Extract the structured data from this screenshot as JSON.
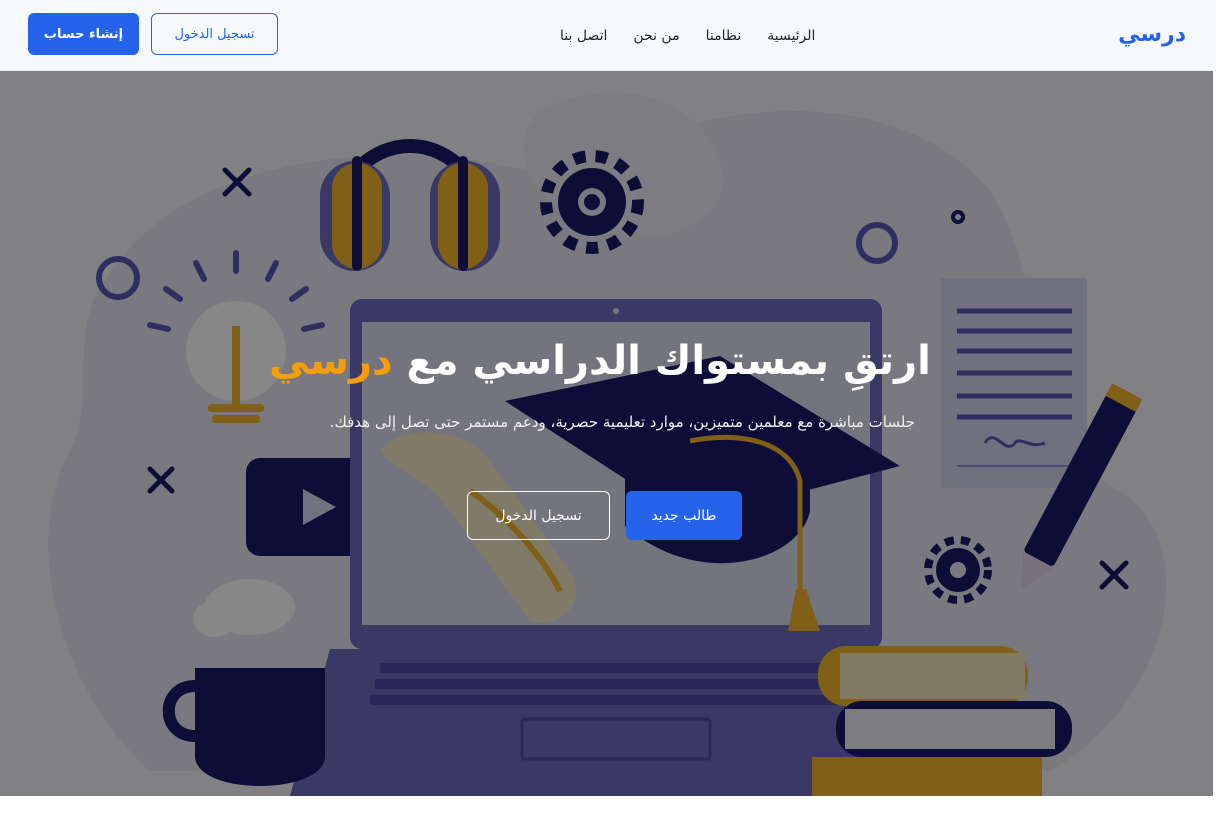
{
  "brand": {
    "name": "درسي",
    "color": "#2563eb"
  },
  "nav": {
    "links": [
      {
        "label": "الرئيسية"
      },
      {
        "label": "نظامنا"
      },
      {
        "label": "من نحن"
      },
      {
        "label": "اتصل بنا"
      }
    ],
    "login_label": "تسجيل الدخول",
    "signup_label": "إنشاء حساب"
  },
  "hero": {
    "title_main": "ارتقِ بمستواك الدراسي مع ",
    "title_accent": "درسي",
    "subtitle": "جلسات مباشرة مع معلمين متميزين، موارد تعليمية حصرية، ودعم مستمر حتى تصل إلى هدفك.",
    "primary_button": "طالب جديد",
    "secondary_button": "تسجيل الدخول"
  },
  "colors": {
    "accent": "#2563eb",
    "highlight": "#f59e0b"
  }
}
